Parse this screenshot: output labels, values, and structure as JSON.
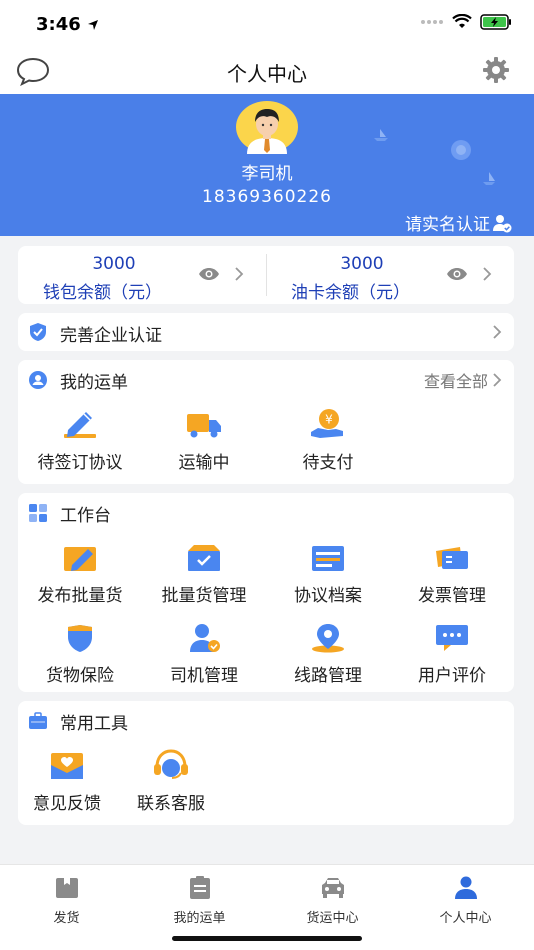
{
  "status": {
    "time": "3:46"
  },
  "nav": {
    "title": "个人中心"
  },
  "profile": {
    "name": "李司机",
    "phone": "18369360226",
    "verify_label": "请实名认证"
  },
  "balances": [
    {
      "value": "3000",
      "label": "钱包余额（元）"
    },
    {
      "value": "3000",
      "label": "油卡余额（元）"
    }
  ],
  "enterprise": {
    "label": "完善企业认证"
  },
  "orders": {
    "title": "我的运单",
    "see_all": "查看全部",
    "items": [
      {
        "label": "待签订协议",
        "icon": "sign-pen-icon"
      },
      {
        "label": "运输中",
        "icon": "truck-icon"
      },
      {
        "label": "待支付",
        "icon": "payment-icon"
      }
    ]
  },
  "workbench": {
    "title": "工作台",
    "items": [
      {
        "label": "发布批量货",
        "icon": "publish-cargo-icon"
      },
      {
        "label": "批量货管理",
        "icon": "cargo-box-icon"
      },
      {
        "label": "协议档案",
        "icon": "archive-icon"
      },
      {
        "label": "发票管理",
        "icon": "invoice-icon"
      },
      {
        "label": "货物保险",
        "icon": "shield-icon"
      },
      {
        "label": "司机管理",
        "icon": "driver-icon"
      },
      {
        "label": "线路管理",
        "icon": "location-icon"
      },
      {
        "label": "用户评价",
        "icon": "comment-icon"
      }
    ]
  },
  "tools": {
    "title": "常用工具",
    "items": [
      {
        "label": "意见反馈",
        "icon": "feedback-icon"
      },
      {
        "label": "联系客服",
        "icon": "headset-icon"
      }
    ]
  },
  "tabs": [
    {
      "label": "发货",
      "icon": "ship-box-icon"
    },
    {
      "label": "我的运单",
      "icon": "waybill-icon"
    },
    {
      "label": "货运中心",
      "icon": "car-icon"
    },
    {
      "label": "个人中心",
      "icon": "person-icon"
    }
  ],
  "colors": {
    "hero_bg": "#4a7fe8",
    "primary_text": "#1e3fb6",
    "icon_blue": "#4a86f0",
    "icon_orange": "#f5a623",
    "active_tab": "#2f6bdc"
  }
}
